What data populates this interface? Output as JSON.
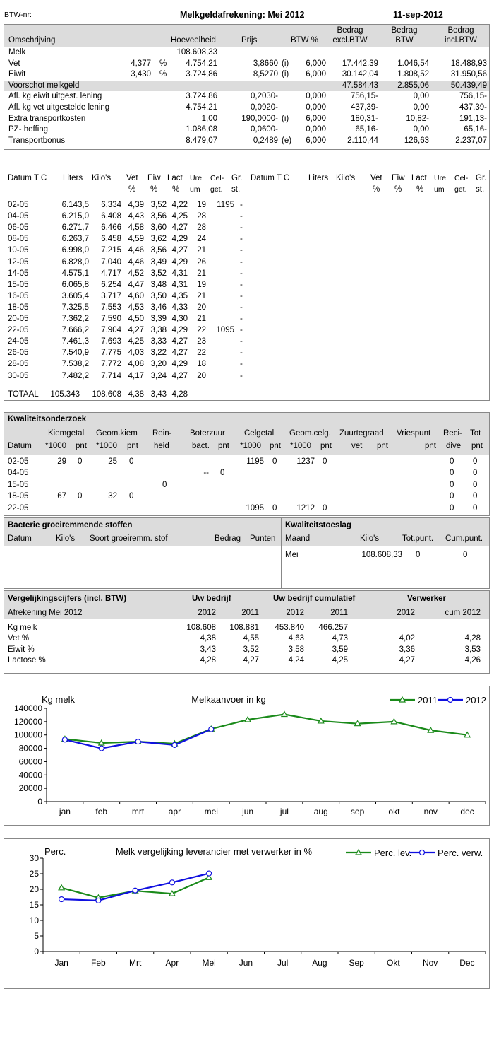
{
  "header": {
    "btw_label": "BTW-nr:",
    "title": "Melkgeldafrekening: Mei 2012",
    "date": "11-sep-2012"
  },
  "summary": {
    "headers": {
      "omschrijving": "Omschrijving",
      "hoeveelheid": "Hoeveelheid",
      "prijs": "Prijs",
      "btw_pct": "BTW %",
      "bedrag_excl_1": "Bedrag",
      "bedrag_excl_2": "excl.BTW",
      "bedrag_btw_1": "Bedrag",
      "bedrag_btw_2": "BTW",
      "bedrag_incl_1": "Bedrag",
      "bedrag_incl_2": "incl.BTW"
    },
    "rows": [
      {
        "desc": "Melk",
        "pct": "",
        "pctsign": "",
        "qty": "108.608,33",
        "price": "",
        "flag": "",
        "btw": "",
        "excl": "",
        "vat": "",
        "incl": "",
        "shaded": false
      },
      {
        "desc": "Vet",
        "pct": "4,377",
        "pctsign": "%",
        "qty": "4.754,21",
        "price": "3,8660",
        "flag": "(i)",
        "btw": "6,000",
        "excl": "17.442,39",
        "vat": "1.046,54",
        "incl": "18.488,93",
        "shaded": false
      },
      {
        "desc": "Eiwit",
        "pct": "3,430",
        "pctsign": "%",
        "qty": "3.724,86",
        "price": "8,5270",
        "flag": "(i)",
        "btw": "6,000",
        "excl": "30.142,04",
        "vat": "1.808,52",
        "incl": "31.950,56",
        "shaded": false
      },
      {
        "desc": "Voorschot melkgeld",
        "pct": "",
        "pctsign": "",
        "qty": "",
        "price": "",
        "flag": "",
        "btw": "",
        "excl": "47.584,43",
        "vat": "2.855,06",
        "incl": "50.439,49",
        "shaded": true
      },
      {
        "desc": "Afl. kg eiwit uitgest. lening",
        "pct": "",
        "pctsign": "",
        "qty": "3.724,86",
        "price": "0,2030-",
        "flag": "",
        "btw": "0,000",
        "excl": "756,15-",
        "vat": "0,00",
        "incl": "756,15-",
        "shaded": false
      },
      {
        "desc": "Afl. kg vet uitgestelde lening",
        "pct": "",
        "pctsign": "",
        "qty": "4.754,21",
        "price": "0,0920-",
        "flag": "",
        "btw": "0,000",
        "excl": "437,39-",
        "vat": "0,00",
        "incl": "437,39-",
        "shaded": false
      },
      {
        "desc": "Extra transportkosten",
        "pct": "",
        "pctsign": "",
        "qty": "1,00",
        "price": "190,0000-",
        "flag": "(i)",
        "btw": "6,000",
        "excl": "180,31-",
        "vat": "10,82-",
        "incl": "191,13-",
        "shaded": false
      },
      {
        "desc": "PZ- heffing",
        "pct": "",
        "pctsign": "",
        "qty": "1.086,08",
        "price": "0,0600-",
        "flag": "",
        "btw": "0,000",
        "excl": "65,16-",
        "vat": "0,00",
        "incl": "65,16-",
        "shaded": false
      },
      {
        "desc": "Transportbonus",
        "pct": "",
        "pctsign": "",
        "qty": "8.479,07",
        "price": "0,2489",
        "flag": "(e)",
        "btw": "6,000",
        "excl": "2.110,44",
        "vat": "126,63",
        "incl": "2.237,07",
        "shaded": false
      }
    ]
  },
  "deliveries": {
    "headers": {
      "datum": "Datum T C",
      "liters": "Liters",
      "kilos": "Kilo's",
      "vet1": "Vet",
      "vet2": "%",
      "eiw1": "Eiw",
      "eiw2": "%",
      "lact1": "Lact",
      "lact2": "%",
      "ure1": "Ure",
      "ure2": "um",
      "cel1": "Cel-",
      "cel2": "get.",
      "gr1": "Gr.",
      "gr2": "st."
    },
    "rows": [
      [
        "02-05",
        "6.143,5",
        "6.334",
        "4,39",
        "3,52",
        "4,22",
        "19",
        "1195",
        "-"
      ],
      [
        "04-05",
        "6.215,0",
        "6.408",
        "4,43",
        "3,56",
        "4,25",
        "28",
        "",
        "-"
      ],
      [
        "06-05",
        "6.271,7",
        "6.466",
        "4,58",
        "3,60",
        "4,27",
        "28",
        "",
        "-"
      ],
      [
        "08-05",
        "6.263,7",
        "6.458",
        "4,59",
        "3,62",
        "4,29",
        "24",
        "",
        "-"
      ],
      [
        "10-05",
        "6.998,0",
        "7.215",
        "4,46",
        "3,56",
        "4,27",
        "21",
        "",
        "-"
      ],
      [
        "12-05",
        "6.828,0",
        "7.040",
        "4,46",
        "3,49",
        "4,29",
        "26",
        "",
        "-"
      ],
      [
        "14-05",
        "4.575,1",
        "4.717",
        "4,52",
        "3,52",
        "4,31",
        "21",
        "",
        "-"
      ],
      [
        "15-05",
        "6.065,8",
        "6.254",
        "4,47",
        "3,48",
        "4,31",
        "19",
        "",
        "-"
      ],
      [
        "16-05",
        "3.605,4",
        "3.717",
        "4,60",
        "3,50",
        "4,35",
        "21",
        "",
        "-"
      ],
      [
        "18-05",
        "7.325,5",
        "7.553",
        "4,53",
        "3,46",
        "4,33",
        "20",
        "",
        "-"
      ],
      [
        "20-05",
        "7.362,2",
        "7.590",
        "4,50",
        "3,39",
        "4,30",
        "21",
        "",
        "-"
      ],
      [
        "22-05",
        "7.666,2",
        "7.904",
        "4,27",
        "3,38",
        "4,29",
        "22",
        "1095",
        "-"
      ],
      [
        "24-05",
        "7.461,3",
        "7.693",
        "4,25",
        "3,33",
        "4,27",
        "23",
        "",
        "-"
      ],
      [
        "26-05",
        "7.540,9",
        "7.775",
        "4,03",
        "3,22",
        "4,27",
        "22",
        "",
        "-"
      ],
      [
        "28-05",
        "7.538,2",
        "7.772",
        "4,08",
        "3,20",
        "4,29",
        "18",
        "",
        "-"
      ],
      [
        "30-05",
        "7.482,2",
        "7.714",
        "4,17",
        "3,24",
        "4,27",
        "20",
        "",
        "-"
      ]
    ],
    "total": [
      "TOTAAL",
      "105.343",
      "108.608",
      "4,38",
      "3,43",
      "4,28"
    ]
  },
  "quality": {
    "title": "Kwaliteitsonderzoek",
    "h1": {
      "kiemgetal": "Kiemgetal",
      "geomkiem": "Geom.kiem",
      "rein": "Rein-",
      "boter": "Boterzuur",
      "celgetal": "Celgetal",
      "geomcelg": "Geom.celg.",
      "zuur": "Zuurtegraad",
      "vries": "Vriespunt",
      "reci": "Reci-",
      "tot": "Tot"
    },
    "h2": {
      "datum": "Datum",
      "k1000": "*1000",
      "kpnt": "pnt",
      "g1000": "*1000",
      "gpnt": "pnt",
      "heid": "heid",
      "bact": "bact.",
      "bpnt": "pnt",
      "c1000": "*1000",
      "cpnt": "pnt",
      "gc1000": "*1000",
      "gcpnt": "pnt",
      "vet": "vet",
      "zpnt": "pnt",
      "vpnt": "pnt",
      "dive": "dive",
      "tpnt": "pnt"
    },
    "rows": [
      {
        "datum": "02-05",
        "k": "29",
        "kp": "0",
        "g": "25",
        "gp": "0",
        "rein": "",
        "bact": "",
        "bp": "",
        "c": "1195",
        "cp": "0",
        "gc": "1237",
        "gcp": "0",
        "reci": "0",
        "tot": "0"
      },
      {
        "datum": "04-05",
        "k": "",
        "kp": "",
        "g": "",
        "gp": "",
        "rein": "",
        "bact": "--",
        "bp": "0",
        "c": "",
        "cp": "",
        "gc": "",
        "gcp": "",
        "reci": "0",
        "tot": "0"
      },
      {
        "datum": "15-05",
        "k": "",
        "kp": "",
        "g": "",
        "gp": "",
        "rein": "0",
        "bact": "",
        "bp": "",
        "c": "",
        "cp": "",
        "gc": "",
        "gcp": "",
        "reci": "0",
        "tot": "0"
      },
      {
        "datum": "18-05",
        "k": "67",
        "kp": "0",
        "g": "32",
        "gp": "0",
        "rein": "",
        "bact": "",
        "bp": "",
        "c": "",
        "cp": "",
        "gc": "",
        "gcp": "",
        "reci": "0",
        "tot": "0"
      },
      {
        "datum": "22-05",
        "k": "",
        "kp": "",
        "g": "",
        "gp": "",
        "rein": "",
        "bact": "",
        "bp": "",
        "c": "1095",
        "cp": "0",
        "gc": "1212",
        "gcp": "0",
        "reci": "0",
        "tot": "0"
      }
    ]
  },
  "bacteria": {
    "title": "Bacterie groeiremmende stoffen",
    "h_datum": "Datum",
    "h_kilos": "Kilo's",
    "h_soort": "Soort groeiremm. stof",
    "h_bedrag": "Bedrag",
    "h_punten": "Punten"
  },
  "toeslag": {
    "title": "Kwaliteitstoeslag",
    "h_maand": "Maand",
    "h_kilos": "Kilo's",
    "h_tot": "Tot.punt.",
    "h_cum": "Cum.punt.",
    "maand": "Mei",
    "kilos": "108.608,33",
    "tot": "0",
    "cum": "0"
  },
  "comparison": {
    "title": "Vergelijkingscijfers (incl. BTW)",
    "g_uw": "Uw bedrijf",
    "g_uwcum": "Uw bedrijf cumulatief",
    "g_verw": "Verwerker",
    "subtitle": "Afrekening Mei 2012",
    "years": [
      "2012",
      "2011",
      "2012",
      "2011",
      "2012",
      "cum 2012"
    ],
    "rows": [
      {
        "label": "Kg melk",
        "vals": [
          "108.608",
          "108.881",
          "453.840",
          "466.257",
          "",
          ""
        ]
      },
      {
        "label": "Vet %",
        "vals": [
          "4,38",
          "4,55",
          "4,63",
          "4,73",
          "4,02",
          "4,28"
        ]
      },
      {
        "label": "Eiwit %",
        "vals": [
          "3,43",
          "3,52",
          "3,58",
          "3,59",
          "3,36",
          "3,53"
        ]
      },
      {
        "label": "Lactose %",
        "vals": [
          "4,28",
          "4,27",
          "4,24",
          "4,25",
          "4,27",
          "4,26"
        ]
      }
    ]
  },
  "chart_data": [
    {
      "type": "line",
      "title": "Melkaanvoer in kg",
      "ylabel": "Kg melk",
      "categories": [
        "jan",
        "feb",
        "mrt",
        "apr",
        "mei",
        "jun",
        "jul",
        "aug",
        "sep",
        "okt",
        "nov",
        "dec"
      ],
      "ylim": [
        0,
        140000
      ],
      "yticks": [
        "0",
        "20000",
        "40000",
        "60000",
        "80000",
        "100000",
        "120000",
        "140000"
      ],
      "grid": false,
      "legend": "top-right",
      "series": [
        {
          "name": "2011",
          "color": "#1a8a1a",
          "marker": "triangle",
          "values": [
            94000,
            88000,
            90000,
            87000,
            109000,
            123000,
            131000,
            121000,
            117000,
            120000,
            107000,
            100000
          ]
        },
        {
          "name": "2012",
          "color": "#1010e0",
          "marker": "circle",
          "values": [
            93000,
            80000,
            90000,
            85000,
            108608
          ]
        }
      ]
    },
    {
      "type": "line",
      "title": "Melk vergelijking leverancier met verwerker in %",
      "ylabel": "Perc.",
      "categories": [
        "Jan",
        "Feb",
        "Mrt",
        "Apr",
        "Mei",
        "Jun",
        "Jul",
        "Aug",
        "Sep",
        "Okt",
        "Nov",
        "Dec"
      ],
      "ylim": [
        0,
        30
      ],
      "yticks": [
        "0",
        "5",
        "10",
        "15",
        "20",
        "25",
        "30"
      ],
      "grid": false,
      "legend": "top-right",
      "series": [
        {
          "name": "Perc. lev.",
          "color": "#1a8a1a",
          "marker": "triangle",
          "values": [
            20.5,
            17.3,
            19.5,
            18.6,
            23.8
          ]
        },
        {
          "name": "Perc. verw.",
          "color": "#1010e0",
          "marker": "circle",
          "values": [
            16.8,
            16.4,
            19.6,
            22.2,
            25.1
          ]
        }
      ]
    }
  ]
}
